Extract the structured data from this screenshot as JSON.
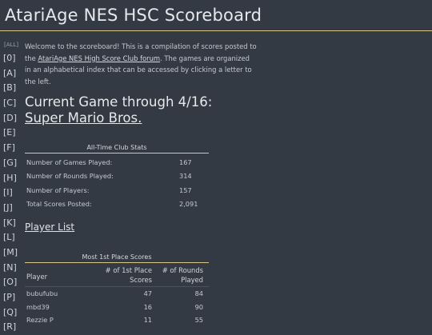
{
  "site": {
    "title": "AtariAge NES HSC Scoreboard"
  },
  "sidebar": {
    "all_label": "[ALL]",
    "letters": [
      "[0]",
      "[A]",
      "[B]",
      "[C]",
      "[D]",
      "[E]",
      "[F]",
      "[G]",
      "[H]",
      "[I]",
      "[J]",
      "[K]",
      "[L]",
      "[M]",
      "[N]",
      "[O]",
      "[P]",
      "[Q]",
      "[R]"
    ]
  },
  "intro": {
    "text_before": "Welcome to the scoreboard! This is a compilation of scores posted to the ",
    "link_text": "AtariAge NES High Score Club forum",
    "text_after": ". The games are organized in an alphabetical index that can be accessed by clicking a letter to the left."
  },
  "current": {
    "heading": "Current Game through 4/16:",
    "game": "Super Mario Bros."
  },
  "club_stats": {
    "caption": "All-Time Club Stats",
    "rows": [
      {
        "label": "Number of Games Played:",
        "value": "167"
      },
      {
        "label": "Number of Rounds Played:",
        "value": "314"
      },
      {
        "label": "Number of Players:",
        "value": "157"
      },
      {
        "label": "Total Scores Posted:",
        "value": "2,091"
      }
    ]
  },
  "player_list_link": "Player List",
  "first_place": {
    "caption": "Most 1st Place Scores",
    "headers": {
      "player": "Player",
      "first_place": "# of 1st Place Scores",
      "rounds": "# of Rounds Played"
    },
    "rows": [
      {
        "player": "bubufubu",
        "first_place": "47",
        "rounds": "84"
      },
      {
        "player": "mbd39",
        "first_place": "16",
        "rounds": "90"
      },
      {
        "player": "Rezzie P",
        "first_place": "11",
        "rounds": "55"
      }
    ]
  }
}
